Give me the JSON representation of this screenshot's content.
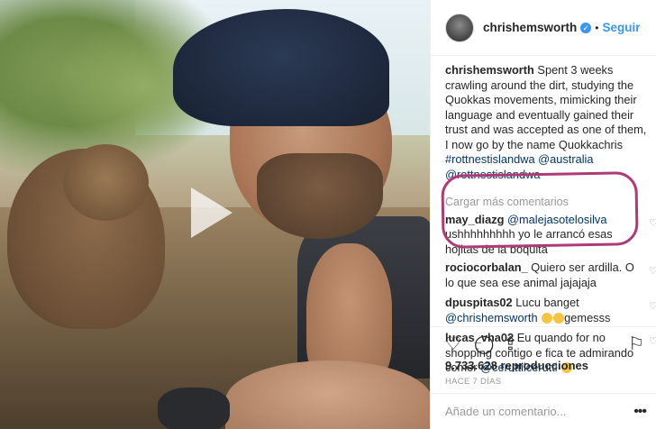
{
  "post": {
    "username": "chrishemsworth",
    "verified": true,
    "follow_label": "Seguir",
    "caption": {
      "user": "chrishemsworth",
      "text": " Spent 3 weeks crawling around the dirt, studying the Quokkas movements, mimicking their language and eventually gained their trust and was accepted as one of them, I now go by the name Quokkachris ",
      "tag1": "#rottnestislandwa",
      "tag2": "@australia",
      "tag3": "@rottnestislandwa"
    },
    "load_more": "Cargar más comentarios",
    "comments": [
      {
        "user": "may_diazg",
        "mention": "@malejasotelosilva",
        "text": " ushhhhhhhhh yo le arrancó esas hojitas de la boquita"
      },
      {
        "user": "rociocorbalan_",
        "text": " Quiero ser ardilla. O lo que sea ese animal jajajaja"
      },
      {
        "user": "dpuspitas02",
        "text": " Lucu banget ",
        "mention": "@chrishemsworth",
        "tail": "gemesss"
      },
      {
        "user": "lucas_vha02",
        "text": " Eu quando for no shopping contigo e fica te admirando comer ",
        "mention": "@ceruttilcerutti"
      }
    ],
    "views": "9.733.628 reproducciones",
    "time_ago": "HACE 7 DÍAS",
    "add_comment_placeholder": "Añade un comentario..."
  },
  "icons": {
    "like": "heart-icon",
    "comment": "comment-icon",
    "share": "share-icon",
    "save": "bookmark-icon",
    "play": "play-icon",
    "more": "more-icon"
  },
  "colors": {
    "link": "#3897f0",
    "tag": "#003569",
    "highlight": "#b03a75"
  }
}
